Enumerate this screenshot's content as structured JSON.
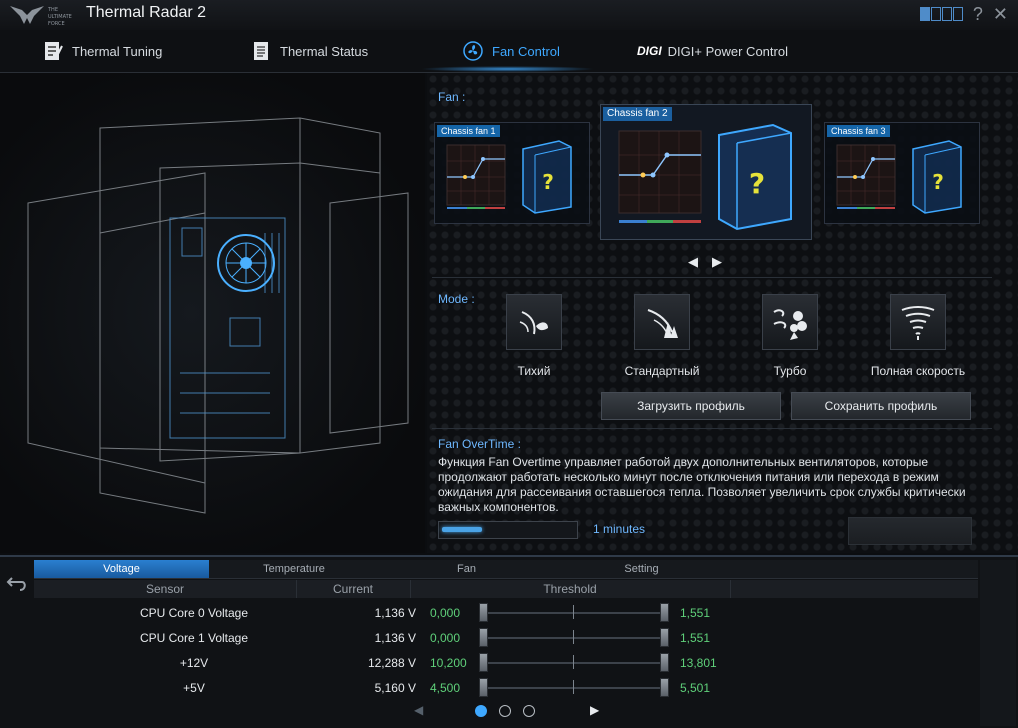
{
  "app": {
    "title": "Thermal Radar 2",
    "logo_text": [
      "THE",
      "ULTIMATE",
      "FORCE"
    ]
  },
  "tabs": [
    {
      "label": "Thermal Tuning",
      "icon": "thermal-tuning-icon"
    },
    {
      "label": "Thermal Status",
      "icon": "document-icon"
    },
    {
      "label": "Fan Control",
      "icon": "fan-icon",
      "active": true
    },
    {
      "label": "DIGI+ Power Control",
      "icon": "digi-power-icon",
      "brand": "DIGI"
    }
  ],
  "fan_section": {
    "label": "Fan :",
    "cards": [
      {
        "title": "Chassis fan 1",
        "icon": "unknown-fan-icon",
        "glyph": "?"
      },
      {
        "title": "Chassis fan 2",
        "icon": "unknown-fan-icon",
        "glyph": "?",
        "selected": true
      },
      {
        "title": "Chassis fan 3",
        "icon": "unknown-fan-icon",
        "glyph": "?"
      }
    ],
    "nav": {
      "prev": "◀",
      "next": "▶"
    }
  },
  "mode_section": {
    "label": "Mode :",
    "modes": [
      {
        "label": "Тихий",
        "icon": "silent-mode-icon"
      },
      {
        "label": "Стандартный",
        "icon": "standard-mode-icon"
      },
      {
        "label": "Турбо",
        "icon": "turbo-mode-icon"
      },
      {
        "label": "Полная скорость",
        "icon": "full-speed-icon"
      }
    ],
    "load_profile": "Загрузить профиль",
    "save_profile": "Сохранить профиль"
  },
  "overtime": {
    "label": "Fan OverTime :",
    "description": "Функция Fan Overtime управляет работой двух дополнительных вентиляторов, которые продолжают работать несколько минут после отключения питания или перехода в режим ожидания для рассеивания оставшегося тепла. Позволяет увеличить срок службы критически важных компонентов.",
    "value": "1 minutes",
    "slider_fraction": 0.3
  },
  "monitor": {
    "subtabs": [
      "Voltage",
      "Temperature",
      "Fan",
      "Setting"
    ],
    "active_subtab": 0,
    "columns": [
      "Sensor",
      "Current",
      "Threshold"
    ],
    "rows": [
      {
        "sensor": "CPU Core 0 Voltage",
        "current": "1,136 V",
        "min": "0,000",
        "max": "1,551"
      },
      {
        "sensor": "CPU Core 1 Voltage",
        "current": "1,136 V",
        "min": "0,000",
        "max": "1,551"
      },
      {
        "sensor": "+12V",
        "current": "12,288 V",
        "min": "10,200",
        "max": "13,801"
      },
      {
        "sensor": "+5V",
        "current": "5,160 V",
        "min": "4,500",
        "max": "5,501"
      }
    ],
    "pager": {
      "pages": 3,
      "current": 0,
      "next": "▶"
    }
  },
  "window_controls": {
    "help": "?",
    "close": "✕"
  },
  "colors": {
    "accent": "#3ea8ff",
    "threshold_green": "#5fd07a",
    "card_header": "#1565a8"
  }
}
